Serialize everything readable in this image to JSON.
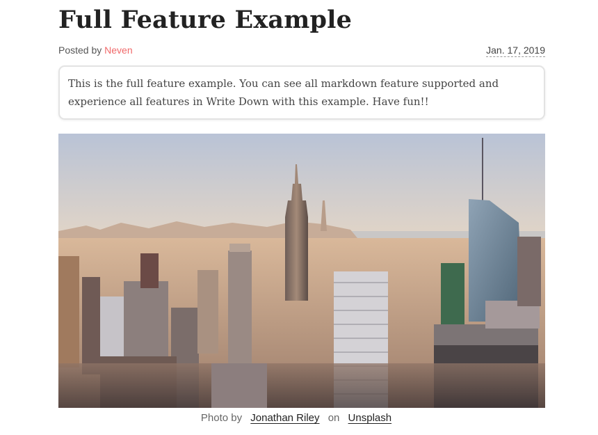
{
  "post": {
    "title": "Full Feature Example",
    "posted_by_label": "Posted by",
    "author": "Neven",
    "date": "Jan. 17, 2019",
    "summary": "This is the full feature example. You can see all markdown feature supported and experience all features in Write Down with this example. Have fun!!"
  },
  "photo_caption": {
    "prefix": "Photo by",
    "photographer": "Jonathan Riley",
    "middle": "on",
    "source": "Unsplash"
  },
  "colors": {
    "accent": "#f0696a",
    "title": "#222222",
    "body_text": "#444444"
  }
}
